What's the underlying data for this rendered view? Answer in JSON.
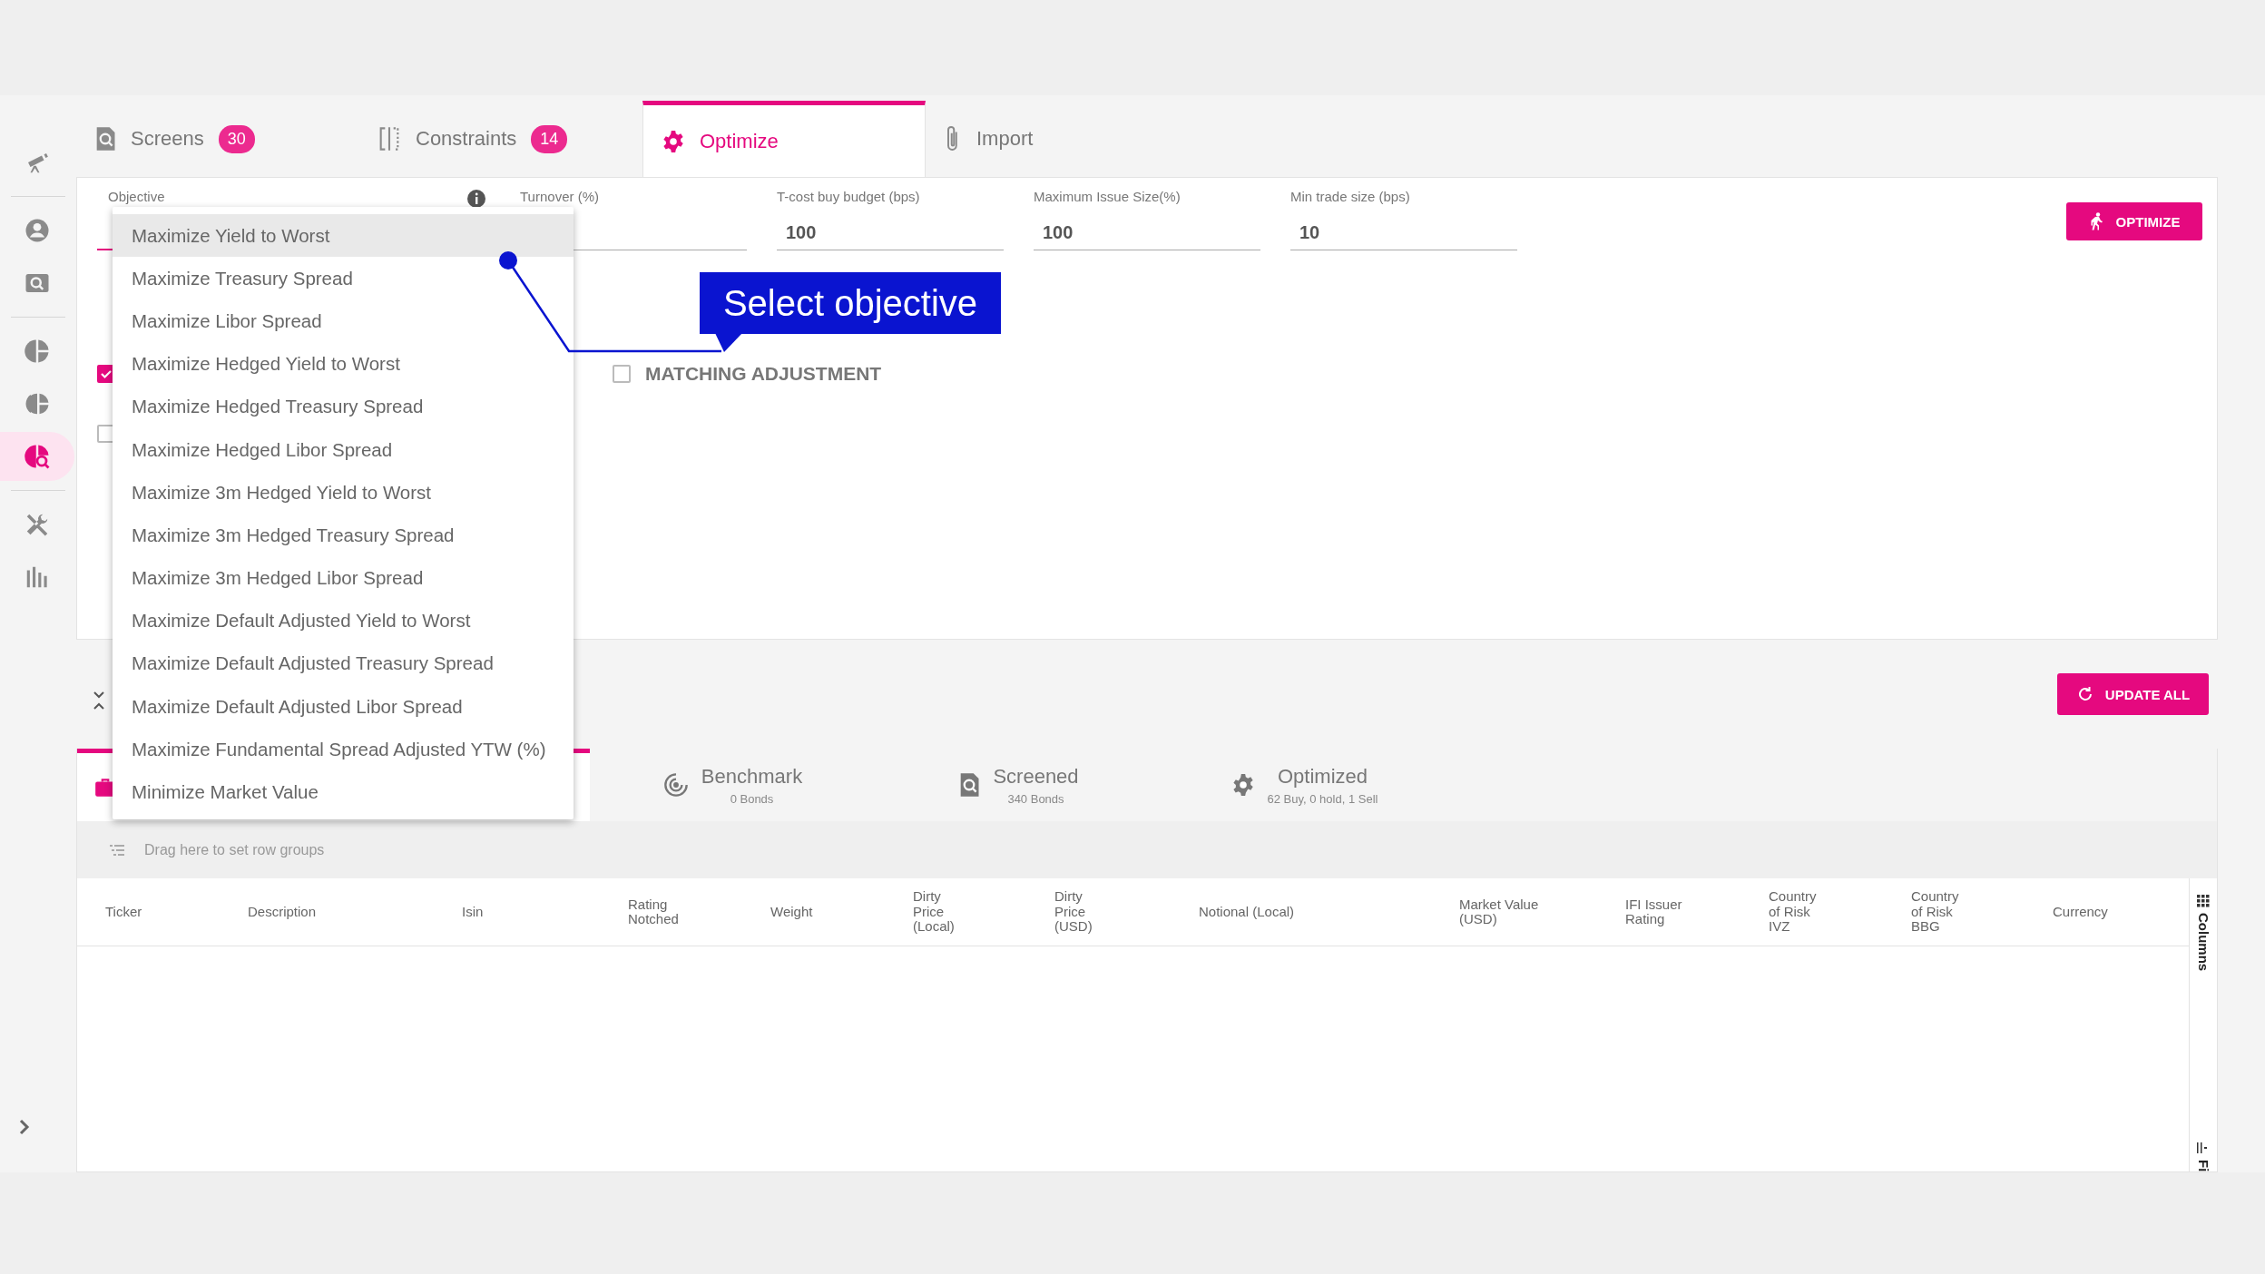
{
  "sidebar": {
    "items": [
      {
        "selected": false
      },
      {
        "selected": false
      },
      {
        "selected": false
      },
      {
        "selected": false
      },
      {
        "selected": false
      },
      {
        "selected": true
      },
      {
        "selected": false
      },
      {
        "selected": false
      }
    ]
  },
  "top_tabs": [
    {
      "label": "Screens",
      "badge": "30",
      "selected": false
    },
    {
      "label": "Constraints",
      "badge": "14",
      "selected": false
    },
    {
      "label": "Optimize",
      "selected": true
    },
    {
      "label": "Import",
      "selected": false
    }
  ],
  "fields": [
    {
      "label": "Objective"
    },
    {
      "label": "Turnover (%)"
    },
    {
      "label": "T-cost buy budget (bps)",
      "value": "100"
    },
    {
      "label": "Maximum Issue Size(%)",
      "value": "100"
    },
    {
      "label": "Min trade size (bps)",
      "value": "10"
    }
  ],
  "optimize_button": "OPTIMIZE",
  "checkboxes": [
    {
      "checked": true
    },
    {
      "label": "MATCHING ADJUSTMENT",
      "checked": false
    },
    {
      "checked": false
    }
  ],
  "objective_dropdown": {
    "options": [
      {
        "label": "Maximize Yield to Worst",
        "selected": true
      },
      {
        "label": "Maximize Treasury Spread",
        "selected": false
      },
      {
        "label": "Maximize Libor Spread",
        "selected": false
      },
      {
        "label": "Maximize Hedged Yield to Worst",
        "selected": false
      },
      {
        "label": "Maximize Hedged Treasury Spread",
        "selected": false
      },
      {
        "label": "Maximize Hedged Libor Spread",
        "selected": false
      },
      {
        "label": "Maximize 3m Hedged Yield to Worst",
        "selected": false
      },
      {
        "label": "Maximize 3m Hedged Treasury Spread",
        "selected": false
      },
      {
        "label": "Maximize 3m Hedged Libor Spread",
        "selected": false
      },
      {
        "label": "Maximize Default Adjusted Yield to Worst",
        "selected": false
      },
      {
        "label": "Maximize Default Adjusted Treasury Spread",
        "selected": false
      },
      {
        "label": "Maximize Default Adjusted Libor Spread",
        "selected": false
      },
      {
        "label": "Maximize Fundamental Spread Adjusted YTW (%)",
        "selected": false
      },
      {
        "label": "Minimize Market Value",
        "selected": false
      }
    ]
  },
  "callout": {
    "text": "Select objective"
  },
  "update_all_button": "UPDATE ALL",
  "result_tabs": [
    {
      "selected": true
    },
    {
      "label": "Benchmark",
      "subtitle": "0 Bonds",
      "selected": false
    },
    {
      "label": "Screened",
      "subtitle": "340 Bonds",
      "selected": false
    },
    {
      "label": "Optimized",
      "subtitle": "62 Buy, 0 hold, 1 Sell",
      "selected": false
    }
  ],
  "row_group_hint": "Drag here to set row groups",
  "table": {
    "columns": [
      "Ticker",
      "Description",
      "Isin",
      "Rating Notched",
      "Weight",
      "Dirty Price (Local)",
      "Dirty Price (USD)",
      "Notional (Local)",
      "Market Value (USD)",
      "IFI Issuer Rating",
      "Country of Risk IVZ",
      "Country of Risk BBG",
      "Currency"
    ]
  },
  "side_panel": {
    "tabs": [
      "Columns",
      "Fi"
    ]
  }
}
